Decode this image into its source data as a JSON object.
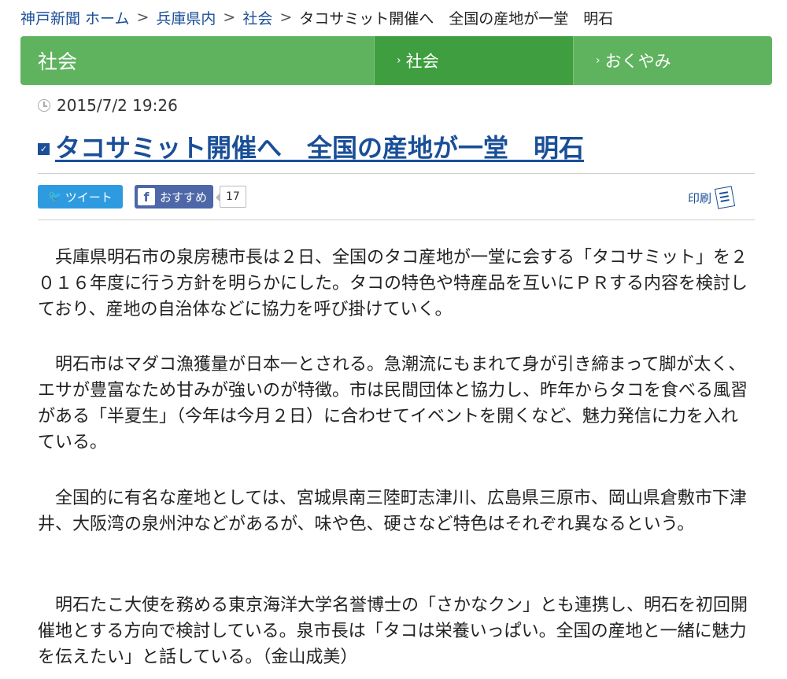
{
  "breadcrumb": {
    "home": "神戸新聞 ホーム",
    "region": "兵庫県内",
    "category": "社会",
    "current": "タコサミット開催へ　全国の産地が一堂　明石",
    "separator": ">"
  },
  "category_bar": {
    "title": "社会",
    "links": [
      "社会",
      "おくやみ"
    ],
    "chevron": "›"
  },
  "article": {
    "datetime": "2015/7/2 19:26",
    "title": "タコサミット開催へ　全国の産地が一堂　明石",
    "paragraphs": [
      "兵庫県明石市の泉房穂市長は２日、全国のタコ産地が一堂に会する「タコサミット」を２０１６年度に行う方針を明らかにした。タコの特色や特産品を互いにＰＲする内容を検討しており、産地の自治体などに協力を呼び掛けていく。",
      "明石市はマダコ漁獲量が日本一とされる。急潮流にもまれて身が引き締まって脚が太く、エサが豊富なため甘みが強いのが特徴。市は民間団体と協力し、昨年からタコを食べる風習がある「半夏生」（今年は今月２日）に合わせてイベントを開くなど、魅力発信に力を入れている。",
      "全国的に有名な産地としては、宮城県南三陸町志津川、広島県三原市、岡山県倉敷市下津井、大阪湾の泉州沖などがあるが、味や色、硬さなど特色はそれぞれ異なるという。",
      "明石たこ大使を務める東京海洋大学名誉博士の「さかなクン」とも連携し、明石を初回開催地とする方向で検討している。泉市長は「タコは栄養いっぱい。全国の産地と一緒に魅力を伝えたい」と話している。（金山成美）"
    ]
  },
  "share": {
    "tweet_label": "ツイート",
    "fb_label": "おすすめ",
    "fb_count": "17",
    "print_label": "印刷"
  },
  "icons": {
    "clock": "clock-icon",
    "check": "checkbox-icon",
    "bird": "twitter-bird-icon",
    "fb": "facebook-icon",
    "print": "print-icon"
  },
  "colors": {
    "link": "#1a4f98",
    "category_bar": "#5fb35f",
    "category_active": "#3f9e3f",
    "tweet": "#2e9be0",
    "facebook": "#4d67a8"
  }
}
